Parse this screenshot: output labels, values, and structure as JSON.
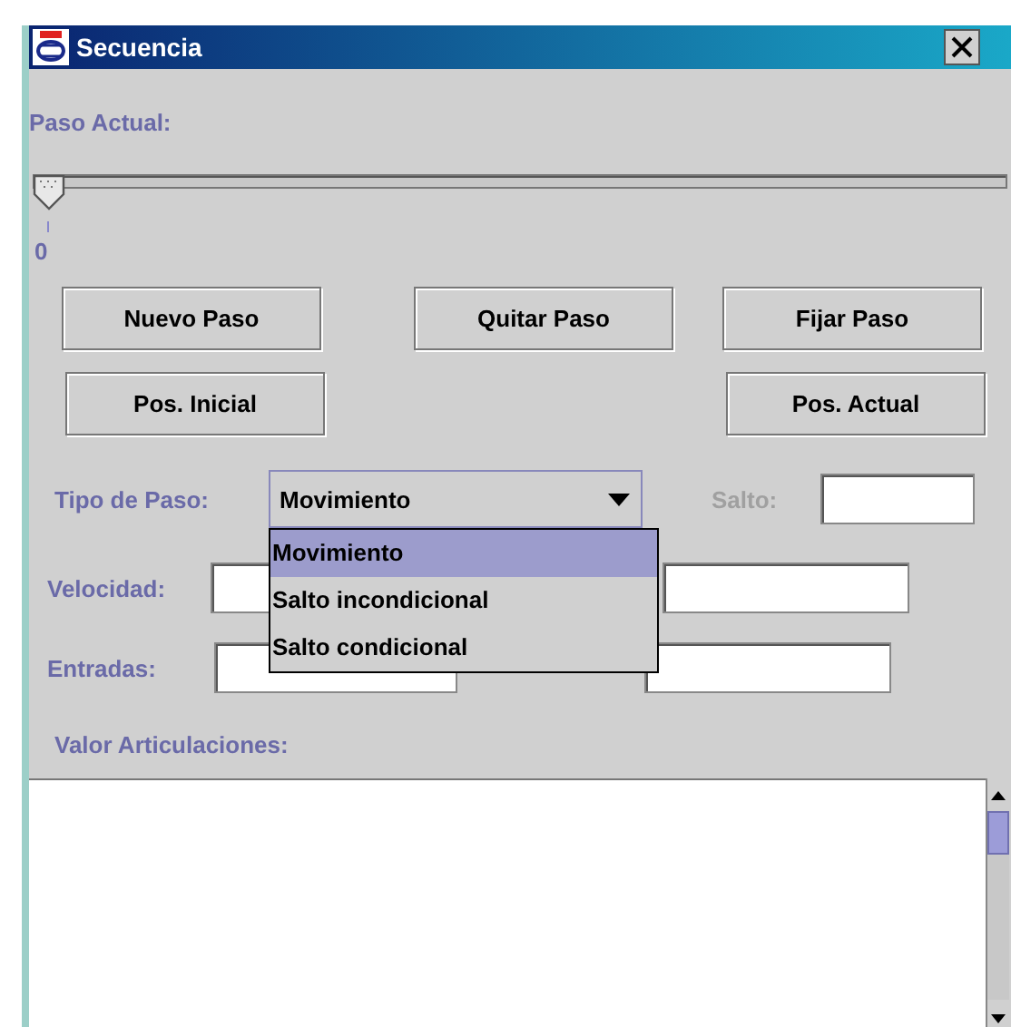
{
  "window": {
    "title": "Secuencia"
  },
  "current_step": {
    "label": "Paso Actual:",
    "level": 0,
    "tick_label": "0"
  },
  "button_rows": [
    {
      "left": [
        "Nuevo Paso"
      ],
      "middle": [
        "Quitar Paso"
      ],
      "right": [
        "Fijar Paso"
      ]
    },
    {
      "left": [
        "Pos. Inicial"
      ],
      "middle": [],
      "right": [
        "Pos. Actual"
      ]
    }
  ],
  "step_type": {
    "label": "Tipo de Paso:",
    "value": "Movimiento",
    "expanded": true,
    "options": [
      {
        "label": "Movimiento",
        "selected": true
      },
      {
        "label": "Salto incondicional",
        "selected": false
      },
      {
        "label": "Salto condicional",
        "selected": false
      }
    ]
  },
  "jump": {
    "label": "Salto:",
    "disabled": true
  },
  "speed": {
    "label": "Velocidad:"
  },
  "inputs": {
    "label": "Entradas:"
  },
  "joint_values": {
    "label": "Valor Articulaciones:"
  }
}
